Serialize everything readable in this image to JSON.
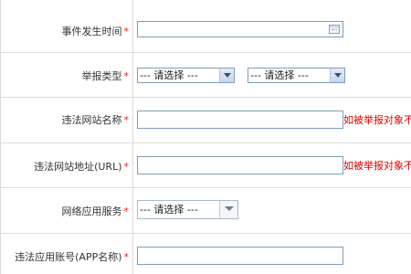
{
  "form": {
    "event_time": {
      "label": "事件发生时间",
      "required": "*",
      "value": ""
    },
    "report_type": {
      "label": "举报类型",
      "required": "*",
      "select1": "--- 请选择  ---",
      "select2": "--- 请选择  ---"
    },
    "site_name": {
      "label": "违法网站名称",
      "required": "*",
      "value": "",
      "hint": "如被举报对象不"
    },
    "site_url": {
      "label": "违法网站地址(URL)",
      "required": "*",
      "value": "",
      "hint": "如被举报对象不"
    },
    "app_service": {
      "label": "网络应用服务",
      "required": "*",
      "select": "--- 请选择  ---"
    },
    "app_account": {
      "label": "违法应用账号(APP名称)",
      "required": "*",
      "value": ""
    }
  },
  "colors": {
    "required": "#e02020",
    "hint": "#e00000",
    "input_border": "#7f9db9"
  }
}
